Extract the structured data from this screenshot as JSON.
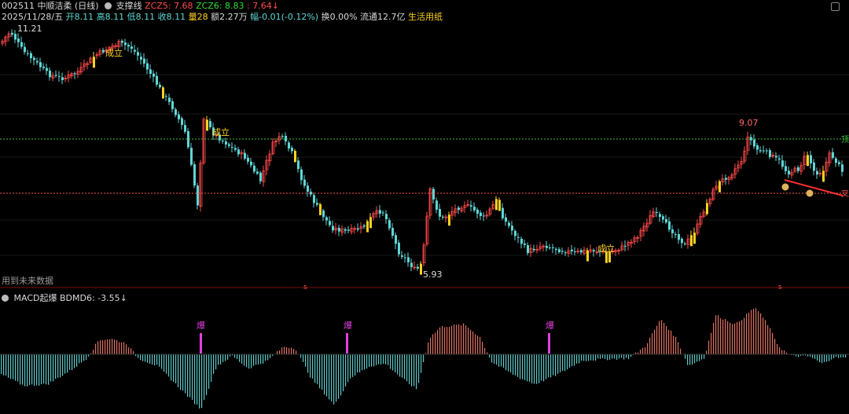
{
  "header": {
    "code": "002511",
    "name": "中顺洁柔",
    "period": "(日线)",
    "indicator": "支撑线",
    "zcz5_label": "ZCZ5:",
    "zcz5_value": "7.68",
    "zcz6_label": "ZCZ6:",
    "zcz6_value": "8.83",
    "zcz7_value": ": 7.64↓",
    "date": "2025/11/28/五",
    "open": "开8.11",
    "high": "高8.11",
    "low": "低8.11",
    "close": "收8.11",
    "volume": "量28",
    "amount": "额2.27万",
    "change": "幅-0.01(-0.12%)",
    "turnover": "换0.00%",
    "float": "流通12.7亿",
    "sector": "生活用纸"
  },
  "main_chart": {
    "high_label": "11.21",
    "low_label": "5.93",
    "peak_label": "9.07",
    "future_data_text": "用到未来数据",
    "established_labels": [
      "成立",
      "成立",
      "成立"
    ],
    "side_labels": [
      "顶",
      "叉"
    ],
    "marker_glyph": "s"
  },
  "macd": {
    "title": "MACD起爆",
    "bdmd_label": "BDMD6:",
    "bdmd_value": "-3.55↓",
    "burst_labels": [
      "爆",
      "爆",
      "爆"
    ]
  },
  "colors": {
    "up": "#ff4a4a",
    "down": "#5fd6d6",
    "yellow": "#ffd21f",
    "magenta": "#e040e0",
    "green_line": "#3cbf3c",
    "red_line": "#ff5050"
  },
  "chart_data": {
    "type": "candlestick",
    "high": 11.21,
    "low": 5.93,
    "peak": 9.07,
    "close": 8.11,
    "support": 7.68,
    "resistance": 8.83,
    "macd_value": -3.55
  }
}
